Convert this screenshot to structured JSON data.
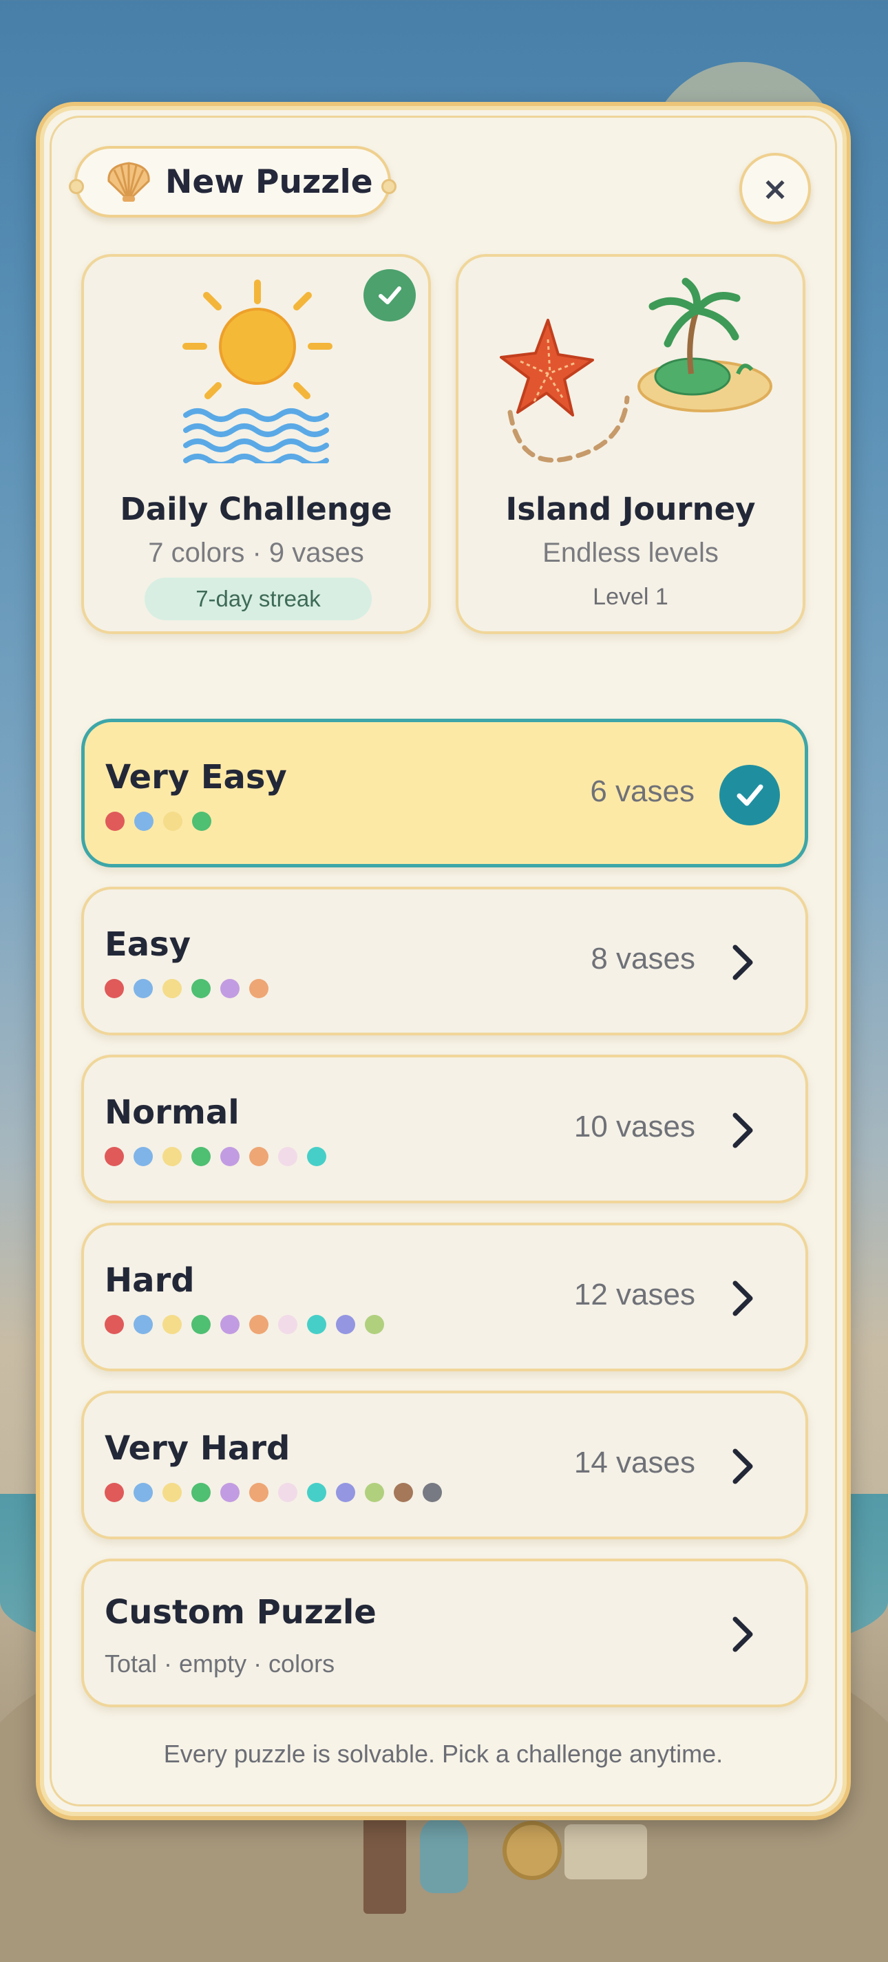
{
  "header": {
    "title": "New Puzzle",
    "close_label": "×"
  },
  "modes": {
    "daily": {
      "title": "Daily Challenge",
      "subtitle": "7 colors · 9 vases",
      "badge": "7-day streak",
      "completed": true
    },
    "journey": {
      "title": "Island Journey",
      "subtitle": "Endless levels",
      "level": "Level 1"
    }
  },
  "difficulties": [
    {
      "name": "Very Easy",
      "count": "6 vases",
      "selected": true,
      "colors": [
        "#e05a5a",
        "#7fb4e8",
        "#f4dc8a",
        "#4fbf72"
      ]
    },
    {
      "name": "Easy",
      "count": "8 vases",
      "selected": false,
      "colors": [
        "#e05a5a",
        "#7fb4e8",
        "#f4dc8a",
        "#4fbf72",
        "#c29ce2",
        "#eea674"
      ]
    },
    {
      "name": "Normal",
      "count": "10 vases",
      "selected": false,
      "colors": [
        "#e05a5a",
        "#7fb4e8",
        "#f4dc8a",
        "#4fbf72",
        "#c29ce2",
        "#eea674",
        "#f2dbe8",
        "#46cfc8"
      ]
    },
    {
      "name": "Hard",
      "count": "12 vases",
      "selected": false,
      "colors": [
        "#e05a5a",
        "#7fb4e8",
        "#f4dc8a",
        "#4fbf72",
        "#c29ce2",
        "#eea674",
        "#f2dbe8",
        "#46cfc8",
        "#9496e2",
        "#b0d07e"
      ]
    },
    {
      "name": "Very Hard",
      "count": "14 vases",
      "selected": false,
      "colors": [
        "#e05a5a",
        "#7fb4e8",
        "#f4dc8a",
        "#4fbf72",
        "#c29ce2",
        "#eea674",
        "#f2dbe8",
        "#46cfc8",
        "#9496e2",
        "#b0d07e",
        "#a5785a",
        "#777a82"
      ]
    }
  ],
  "custom": {
    "name": "Custom Puzzle",
    "subtitle": "Total · empty · colors"
  },
  "footer": "Every puzzle is solvable. Pick a challenge anytime.",
  "accent": {
    "selected_border": "#3da6a8",
    "selected_bg": "#fde9a6",
    "check": "#1f8fa0",
    "daily_check": "#4ca16d"
  }
}
